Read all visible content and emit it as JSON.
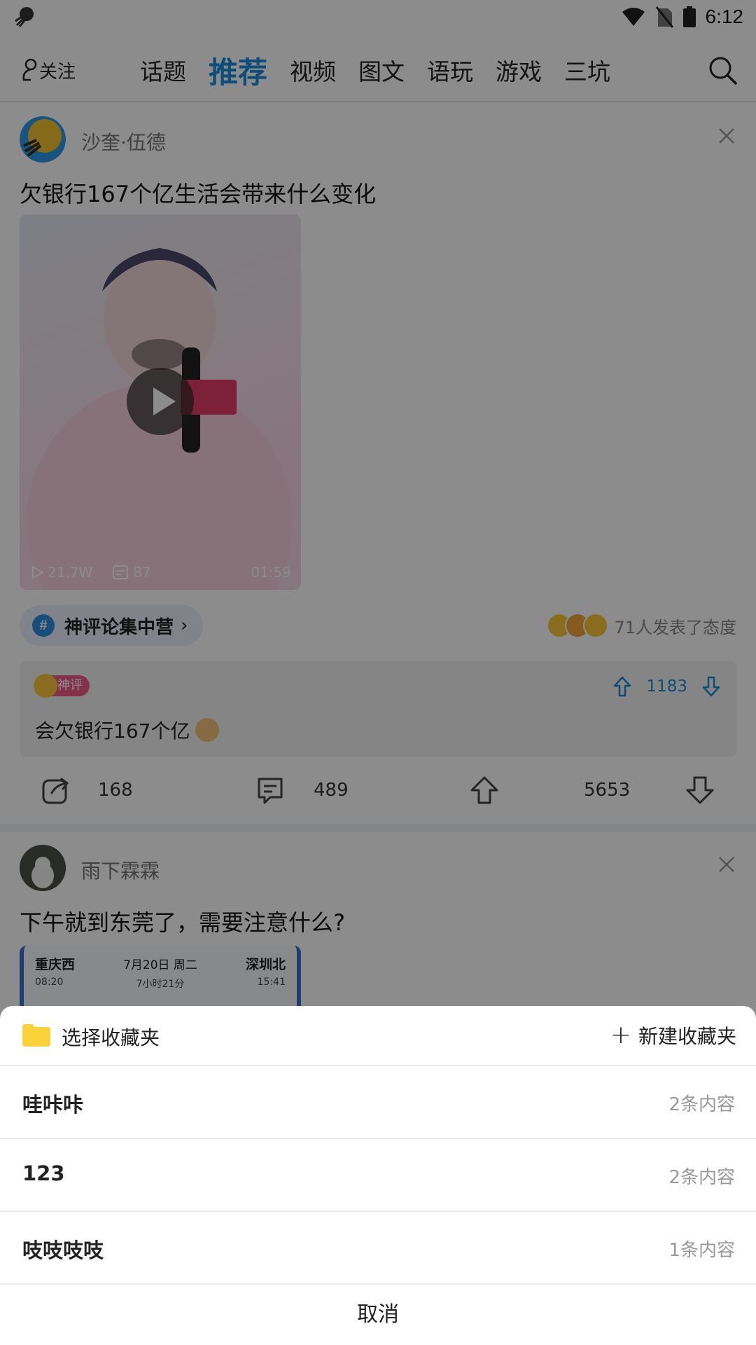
{
  "status_bar": {
    "time": "6:12"
  },
  "nav": {
    "follow": "关注",
    "tabs": [
      {
        "label": "话题"
      },
      {
        "label": "推荐",
        "active": true
      },
      {
        "label": "视频"
      },
      {
        "label": "图文"
      },
      {
        "label": "语玩"
      },
      {
        "label": "游戏"
      },
      {
        "label": "三坑"
      }
    ]
  },
  "post1": {
    "username": "沙奎·伍德",
    "title": "欠银行167个亿生活会带来什么变化",
    "video": {
      "plays": "21.7W",
      "comments": "87",
      "duration": "01:59"
    },
    "topic": "神评论集中营",
    "attitude_text": "71人发表了态度",
    "god_comment": {
      "badge": "神评",
      "text": "会欠银行167个亿",
      "up_votes": "1183"
    },
    "actions": {
      "share": "168",
      "comment": "489",
      "like": "5653"
    }
  },
  "post2": {
    "username": "雨下霖霖",
    "title": "下午就到东莞了，需要注意什么?",
    "ticket": {
      "from": "重庆西",
      "date": "7月20日 周二",
      "to": "深圳北",
      "depart": "08:20",
      "duration": "7小时21分",
      "arrive": "15:41"
    }
  },
  "sheet": {
    "title": "选择收藏夹",
    "new_button": "新建收藏夹",
    "folders": [
      {
        "name": "哇咔咔",
        "count": "2条内容"
      },
      {
        "name": "123",
        "count": "2条内容"
      },
      {
        "name": "吱吱吱吱",
        "count": "1条内容"
      }
    ],
    "cancel": "取消"
  },
  "colors": {
    "accent": "#1a8cdb",
    "folder": "#f9d23b",
    "badge": "#f0598a"
  }
}
